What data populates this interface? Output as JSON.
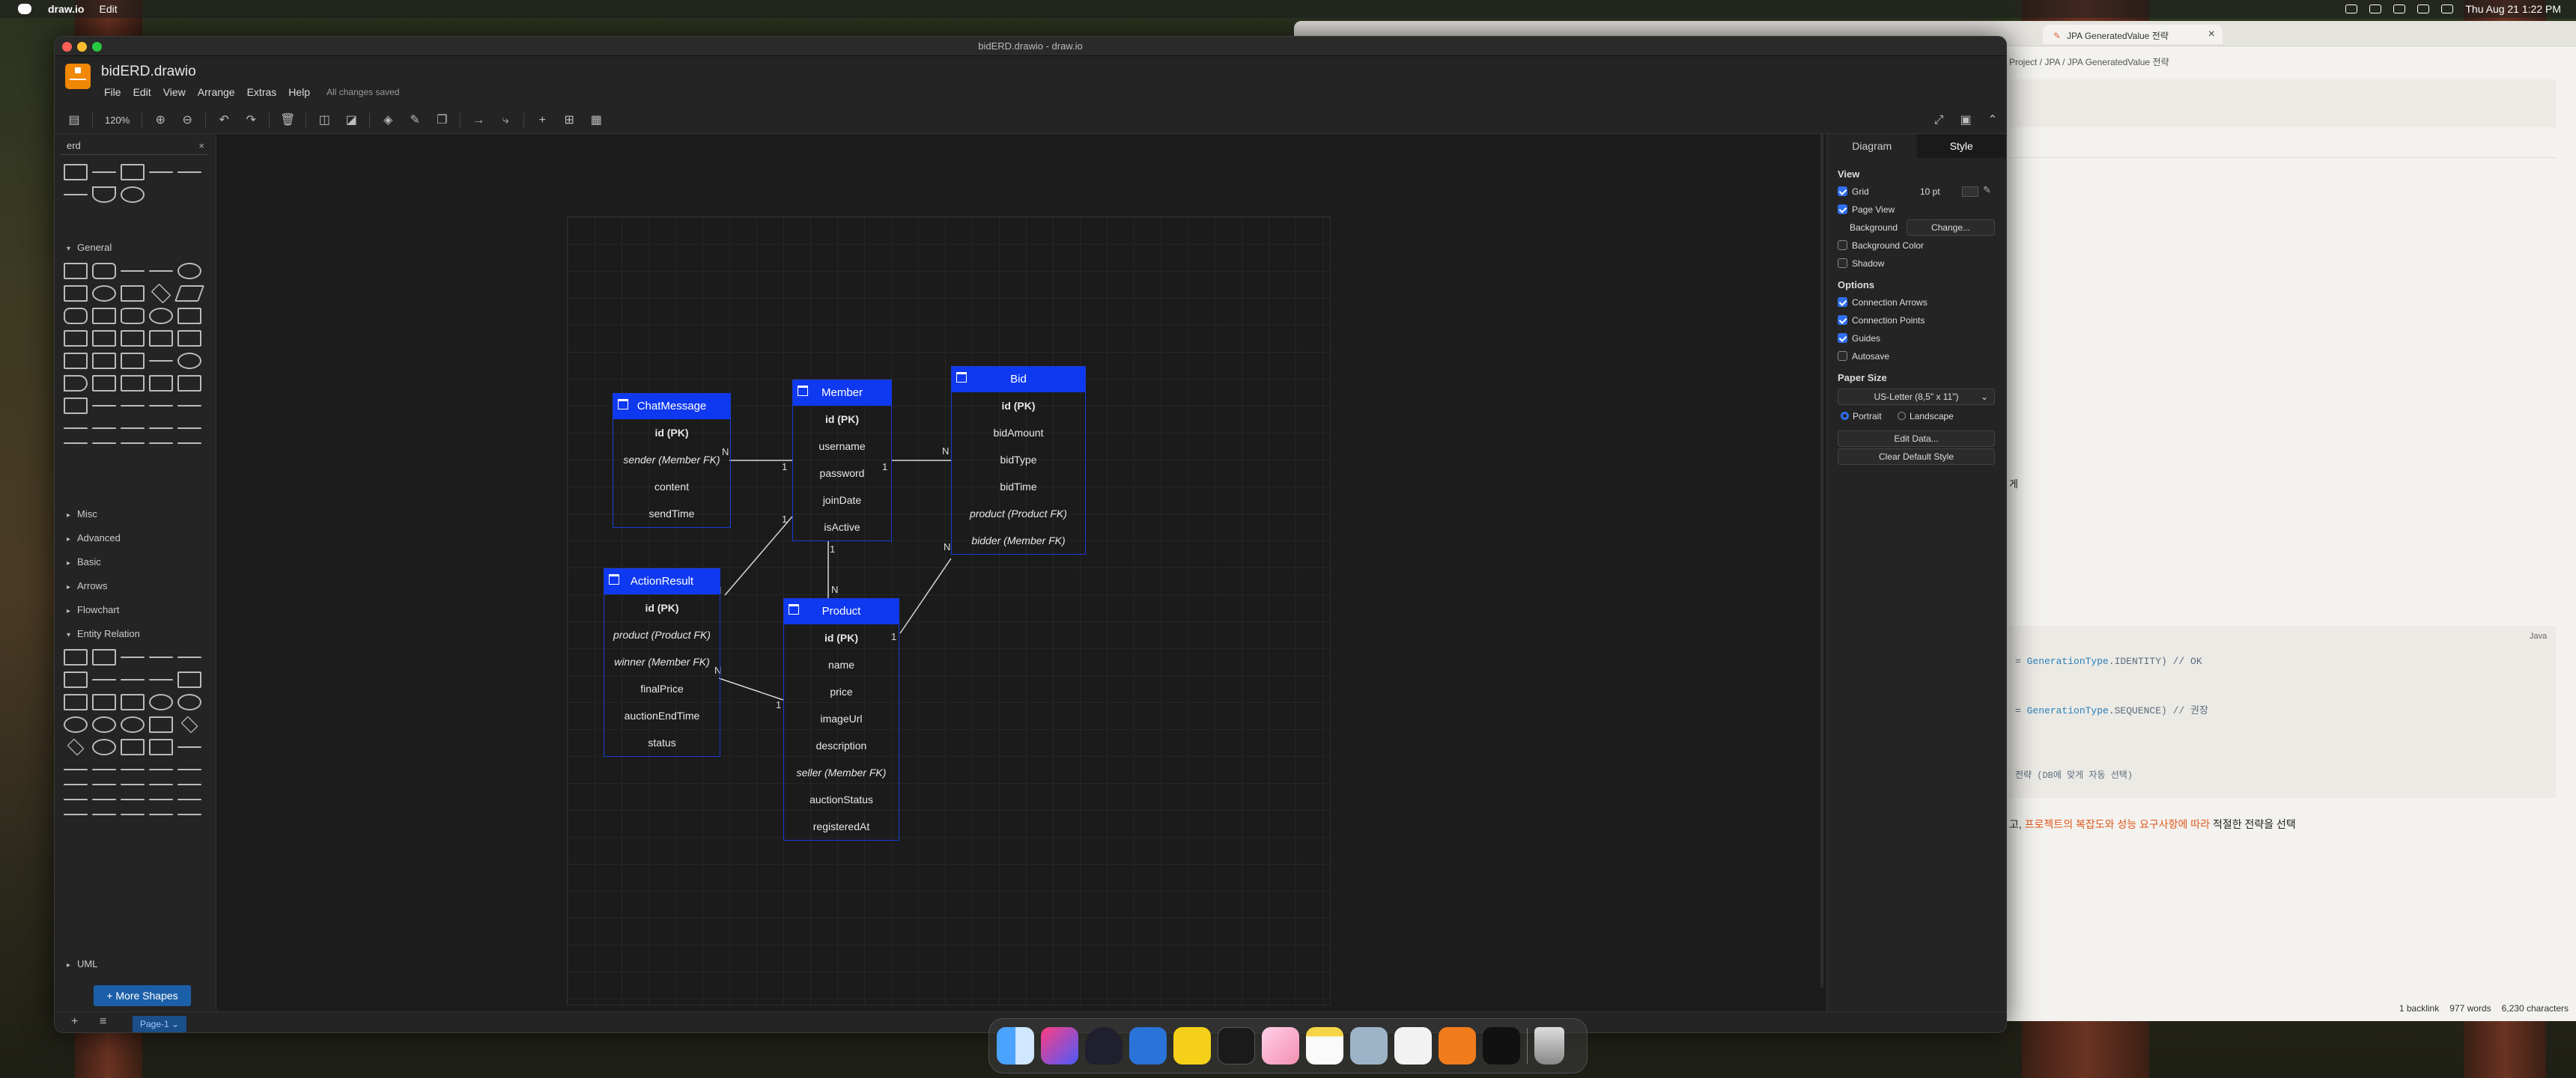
{
  "menubar": {
    "app": "draw.io",
    "menu": "Edit",
    "clock": "Thu Aug 21  1:22 PM"
  },
  "back_window": {
    "active_tab": "JPA GeneratedValue 전략",
    "breadcrumb": "Project  /  JPA  /  JPA GeneratedValue 전략",
    "fragment_ge": "게",
    "code_lang": "Java",
    "code1": {
      "pre": "= ",
      "k": "GenerationType",
      "post": ".IDENTITY) // OK"
    },
    "code2": {
      "pre": "= ",
      "k": "GenerationType",
      "post": ".SEQUENCE) // 권장"
    },
    "code3": "전략 (DB에 맞게 자동 선택)",
    "ko_pre": "고, ",
    "ko_hl": "프로젝트의 복잡도와 성능 요구사항에 따라",
    "ko_post": " 적절한 전략을 선택",
    "status_backlink": "1 backlink",
    "status_words": "977 words",
    "status_chars": "6,230 characters"
  },
  "window": {
    "title": "bidERD.drawio - draw.io",
    "filename": "bidERD.drawio",
    "saved": "All changes saved",
    "menus": [
      "File",
      "Edit",
      "View",
      "Arrange",
      "Extras",
      "Help"
    ]
  },
  "toolbar": {
    "zoom": "120%"
  },
  "sidebar": {
    "search": "erd",
    "sections": [
      "General",
      "Misc",
      "Advanced",
      "Basic",
      "Arrows",
      "Flowchart",
      "Entity Relation",
      "UML"
    ],
    "more_shapes": "+ More Shapes"
  },
  "entities": {
    "chat": {
      "title": "ChatMessage",
      "rows": [
        "id (PK)",
        "sender (Member FK)",
        "content",
        "sendTime"
      ]
    },
    "member": {
      "title": "Member",
      "rows": [
        "id (PK)",
        "username",
        "password",
        "joinDate",
        "isActive"
      ]
    },
    "bid": {
      "title": "Bid",
      "rows": [
        "id (PK)",
        "bidAmount",
        "bidType",
        "bidTime",
        "product (Product FK)",
        "bidder (Member FK)"
      ]
    },
    "auction": {
      "title": "ActionResult",
      "rows": [
        "id (PK)",
        "product (Product FK)",
        "winner (Member FK)",
        "finalPrice",
        "auctionEndTime",
        "status"
      ]
    },
    "product": {
      "title": "Product",
      "rows": [
        "id (PK)",
        "name",
        "price",
        "imageUrl",
        "description",
        "seller (Member FK)",
        "auctionStatus",
        "registeredAt"
      ]
    }
  },
  "cardinality": {
    "n": "N",
    "one": "1"
  },
  "right_panel": {
    "tabs": [
      "Diagram",
      "Style"
    ],
    "view": "View",
    "grid": "Grid",
    "grid_size": "10 pt",
    "page_view": "Page View",
    "background": "Background",
    "change": "Change...",
    "bg_color": "Background Color",
    "shadow": "Shadow",
    "options": "Options",
    "conn_arrows": "Connection Arrows",
    "conn_points": "Connection Points",
    "guides": "Guides",
    "autosave": "Autosave",
    "paper_size": "Paper Size",
    "paper": "US-Letter (8,5\" x 11\")",
    "portrait": "Portrait",
    "landscape": "Landscape",
    "edit_data": "Edit Data...",
    "clear_style": "Clear Default Style"
  },
  "bottom": {
    "page": "Page-1"
  },
  "colors": {
    "entity_header": "#0f39f0",
    "entity_border": "#1a3bd6",
    "brand": "#f08705"
  }
}
